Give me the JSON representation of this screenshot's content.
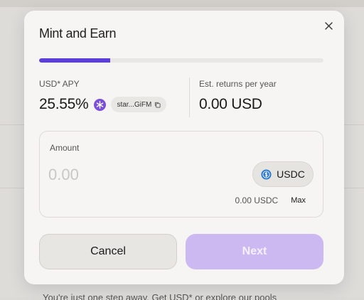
{
  "modal": {
    "title": "Mint and Earn",
    "close_icon": "close-icon",
    "progress_fraction": 0.25
  },
  "stats": {
    "apy_label": "USD* APY",
    "apy_value": "25.55%",
    "apy_badge_icon": "star-icon",
    "address": "star...GiFM",
    "address_icon": "copy-icon",
    "returns_label": "Est. returns per year",
    "returns_value": "0.00 USD"
  },
  "amount": {
    "label": "Amount",
    "placeholder": "0.00",
    "value": "",
    "currency": "USDC",
    "currency_icon": "usdc-icon",
    "balance": "0.00 USDC",
    "max_label": "Max"
  },
  "buttons": {
    "cancel": "Cancel",
    "next": "Next"
  },
  "background": {
    "text": "You're just one step away. Get USD* or explore our pools"
  },
  "colors": {
    "accent": "#5b3fd6",
    "next_disabled": "#cdb9f2",
    "usdc_blue": "#2775ca"
  }
}
